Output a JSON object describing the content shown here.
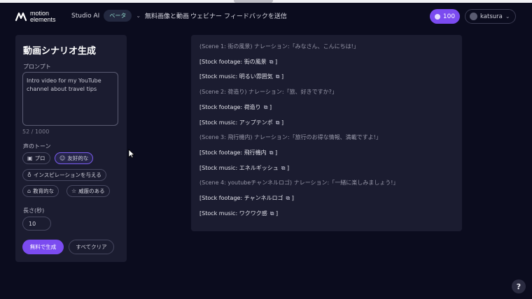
{
  "brand": {
    "logo_line1": "motion",
    "logo_line2": "elements",
    "logo_icon": "motionelements-logo-icon"
  },
  "nav": {
    "studio": "Studio AI",
    "beta_badge": "ベータ",
    "free_media": "無料画像と動画",
    "webinar": "ウェビナー",
    "feedback": "フィードバックを送信"
  },
  "account": {
    "credits": "100",
    "username": "katsura"
  },
  "form": {
    "title": "動画シナリオ生成",
    "prompt_label": "プロンプト",
    "prompt_value": "Intro video for my YouTube channel about travel tips",
    "char_count": "52 / 1000",
    "tone_label": "声のトーン",
    "tones": [
      {
        "label": "プロ",
        "icon": "briefcase-icon",
        "selected": false
      },
      {
        "label": "友好的な",
        "icon": "smile-icon",
        "selected": true
      },
      {
        "label": "インスピレーションを与える",
        "icon": "lightbulb-icon",
        "selected": false
      },
      {
        "label": "教育的な",
        "icon": "graduation-cap-icon",
        "selected": false
      },
      {
        "label": "威厳のある",
        "icon": "star-icon",
        "selected": false
      }
    ],
    "length_label": "長さ(秒)",
    "length_value": "10",
    "generate_label": "無料で生成",
    "clear_label": "すべてクリア"
  },
  "result": {
    "lines": [
      {
        "type": "scene",
        "text": "(Scene 1: 街の風景) ナレーション:「みなさん、こんにちは!」"
      },
      {
        "type": "stock",
        "text": "[Stock footage: 街の風景",
        "close": "]"
      },
      {
        "type": "stock",
        "text": "[Stock music: 明るい雰囲気",
        "close": "]"
      },
      {
        "type": "scene",
        "text": "(Scene 2: 荷造り) ナレーション:「旅、好きですか?」"
      },
      {
        "type": "stock",
        "text": "[Stock footage: 荷造り",
        "close": "]"
      },
      {
        "type": "stock",
        "text": "[Stock music: アップテンポ",
        "close": "]"
      },
      {
        "type": "scene",
        "text": "(Scene 3: 飛行機内) ナレーション:「旅行のお得な情報、満載ですよ!」"
      },
      {
        "type": "stock",
        "text": "[Stock footage: 飛行機内",
        "close": "]"
      },
      {
        "type": "stock",
        "text": "[Stock music: エネルギッシュ",
        "close": "]"
      },
      {
        "type": "scene",
        "text": "(Scene 4: youtubeチャンネルロゴ) ナレーション:「一緒に楽しみましょう!」"
      },
      {
        "type": "stock",
        "text": "[Stock footage: チャンネルロゴ",
        "close": "]"
      },
      {
        "type": "stock",
        "text": "[Stock music: ワクワク感",
        "close": "]"
      }
    ]
  },
  "help_label": "?",
  "colors": {
    "accent": "#7b4bf0",
    "background": "#0b0c1e",
    "panel": "#1b1c30"
  }
}
